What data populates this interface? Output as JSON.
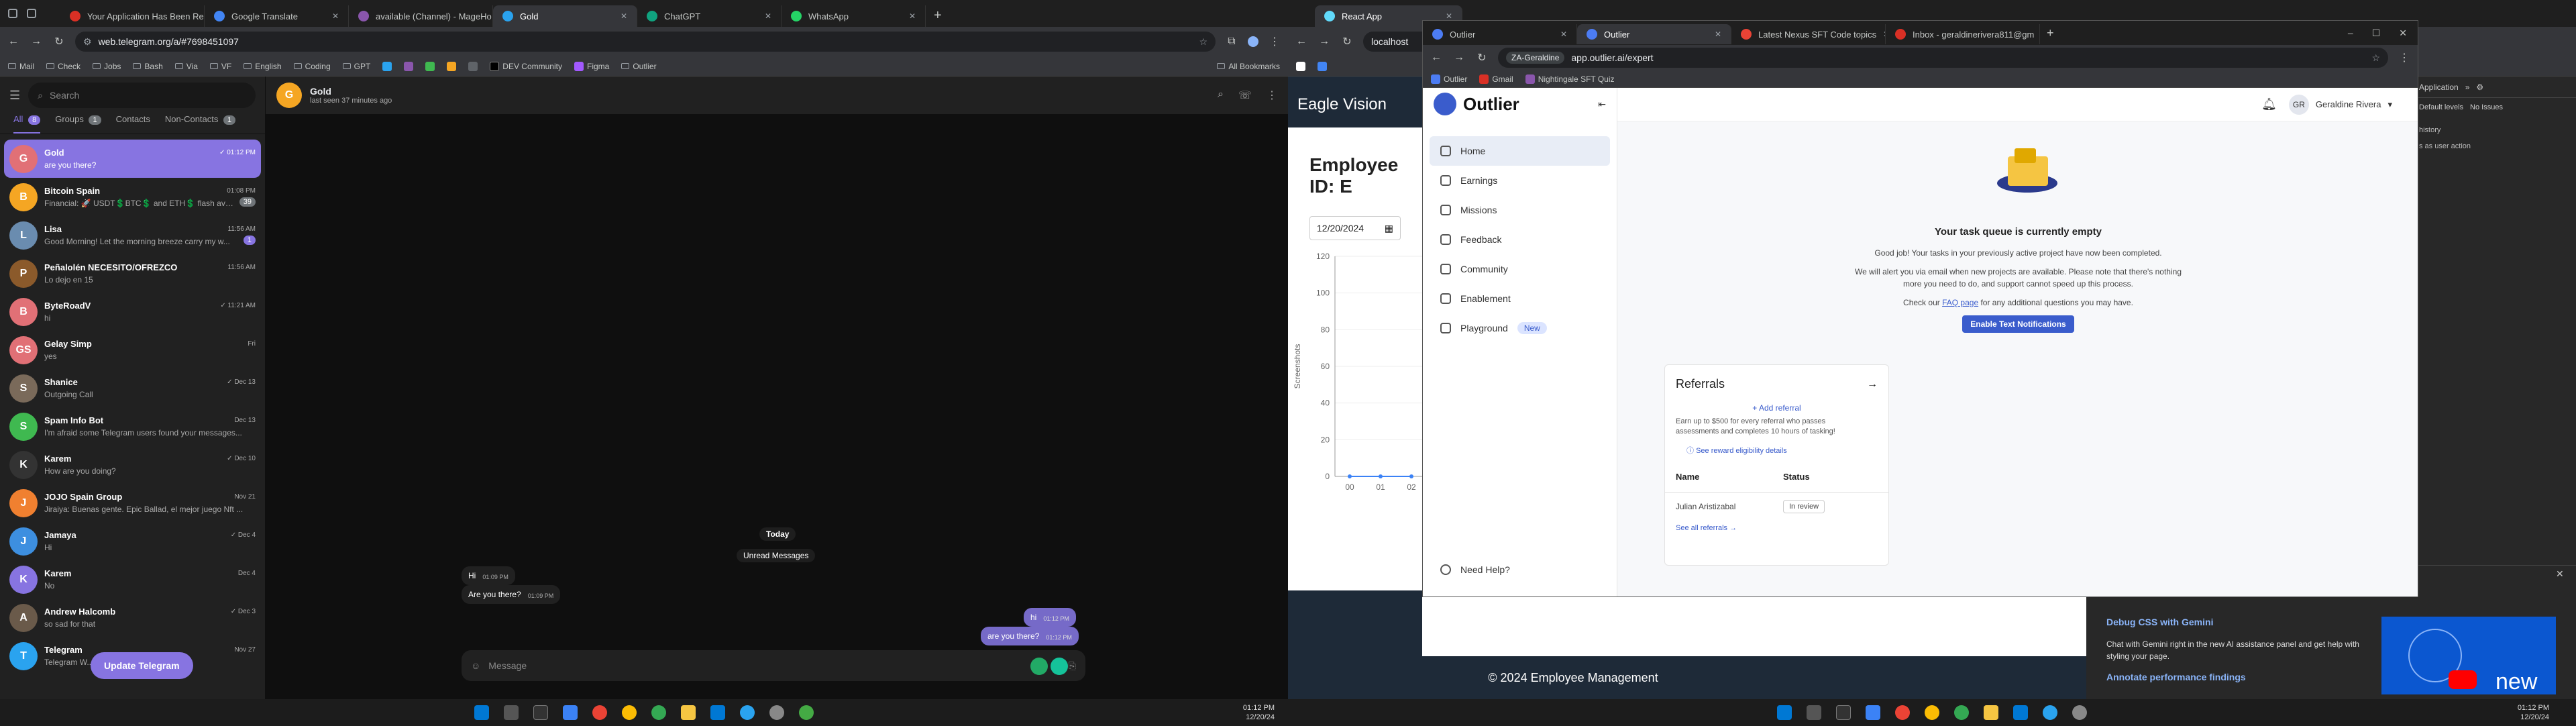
{
  "left_browser": {
    "tabs": [
      "Your Application Has Been Rec",
      "Google Translate",
      "available (Channel) - MageHo",
      "Gold",
      "ChatGPT",
      "WhatsApp"
    ],
    "active_tab": 3,
    "url": "web.telegram.org/a/#7698451097",
    "bookmarks": [
      "Mail",
      "Check",
      "Jobs",
      "Bash",
      "Via",
      "VF",
      "English",
      "Coding",
      "GPT",
      "DEV Community",
      "Figma",
      "Outlier"
    ],
    "all_bookmarks": "All Bookmarks"
  },
  "telegram": {
    "search_placeholder": "Search",
    "filters": [
      {
        "label": "All",
        "count": "8"
      },
      {
        "label": "Groups",
        "count": "1"
      },
      {
        "label": "Contacts",
        "count": ""
      },
      {
        "label": "Non-Contacts",
        "count": "1"
      }
    ],
    "chats": [
      {
        "name": "Gold",
        "time": "✓ 01:12 PM",
        "msg": "are you there?",
        "initial": "G",
        "color": "#e17076",
        "badge": ""
      },
      {
        "name": "Bitcoin Spain",
        "time": "01:08 PM",
        "msg": "Financial: 🚀 USDT💲BTC💲 and ETH💲 flash avail...",
        "initial": "B",
        "color": "#f5a623",
        "badge": "39"
      },
      {
        "name": "Lisa",
        "time": "11:56 AM",
        "msg": "Good Morning! Let the morning breeze carry my w...",
        "initial": "L",
        "color": "#6a8caf",
        "badge": "1"
      },
      {
        "name": "Peñalolén NECESITO/OFREZCO",
        "time": "11:56 AM",
        "msg": "Lo dejo en 15",
        "initial": "P",
        "color": "#8b5a2b",
        "badge": ""
      },
      {
        "name": "ByteRoadV",
        "time": "✓ 11:21 AM",
        "msg": "hi",
        "initial": "B",
        "color": "#e17076",
        "badge": ""
      },
      {
        "name": "Gelay Simp",
        "time": "Fri",
        "msg": "yes",
        "initial": "GS",
        "color": "#e17076",
        "badge": ""
      },
      {
        "name": "Shanice",
        "time": "✓ Dec 13",
        "msg": "Outgoing Call",
        "initial": "S",
        "color": "#7a6a5a",
        "badge": ""
      },
      {
        "name": "Spam Info Bot",
        "time": "Dec 13",
        "msg": "I'm afraid some Telegram users found your messages...",
        "initial": "S",
        "color": "#3fb950",
        "badge": ""
      },
      {
        "name": "Karem",
        "time": "✓ Dec 10",
        "msg": "How are you doing?",
        "initial": "K",
        "color": "#333",
        "badge": ""
      },
      {
        "name": "JOJO Spain Group",
        "time": "Nov 21",
        "msg": "Jiraiya: Buenas gente. Epic Ballad, el mejor juego Nft ...",
        "initial": "J",
        "color": "#f08030",
        "badge": ""
      },
      {
        "name": "Jamaya",
        "time": "✓ Dec 4",
        "msg": "Hi",
        "initial": "J",
        "color": "#3d8fe0",
        "badge": ""
      },
      {
        "name": "Karem",
        "time": "Dec 4",
        "msg": "No",
        "initial": "K",
        "color": "#8774e1",
        "badge": ""
      },
      {
        "name": "Andrew Halcomb",
        "time": "✓ Dec 3",
        "msg": "so sad for that",
        "initial": "A",
        "color": "#6a5a4a",
        "badge": ""
      },
      {
        "name": "Telegram",
        "time": "Nov 27",
        "msg": "Telegram W... features and useful...",
        "initial": "T",
        "color": "#2aa3ef",
        "badge": ""
      }
    ],
    "update_button": "Update Telegram",
    "header": {
      "name": "Gold",
      "status": "last seen 37 minutes ago",
      "initial": "G"
    },
    "date_label": "Today",
    "unread_label": "Unread Messages",
    "messages": [
      {
        "text": "Hi",
        "time": "01:09 PM",
        "out": false
      },
      {
        "text": "Are you there?",
        "time": "01:09 PM",
        "out": false
      },
      {
        "text": "hi",
        "time": "01:12 PM",
        "out": true
      },
      {
        "text": "are you there?",
        "time": "01:12 PM",
        "out": true
      }
    ],
    "message_placeholder": "Message"
  },
  "right_browser": {
    "tabs": [
      "React App"
    ],
    "url": "localhost",
    "page_title": "Eagle Vision",
    "heading": "Employee ID: E",
    "date_value": "12/20/2024",
    "chart_data": {
      "type": "line",
      "ylabel": "Screenshots",
      "yticks": [
        "120",
        "100",
        "80",
        "60",
        "40",
        "20",
        "0"
      ],
      "xticks": [
        "00",
        "01",
        "02"
      ],
      "ylim": [
        0,
        120
      ],
      "values": [
        0,
        0,
        0
      ]
    },
    "footer": "© 2024 Employee Management",
    "devtools": {
      "tabs": [
        "Application"
      ],
      "levels": "Default levels",
      "issues": "No Issues",
      "lines": [
        "history",
        "s as user action"
      ]
    },
    "gemini": {
      "title": "Debug CSS with Gemini",
      "desc": "Chat with Gemini right in the new AI assistance panel and get help with styling your page.",
      "link": "Annotate performance findings",
      "video_text": "new"
    }
  },
  "outlier_window": {
    "tabs": [
      "Outlier",
      "Outlier",
      "Latest Nexus SFT Code topics",
      "Inbox - geraldinerivera811@gm"
    ],
    "profile_chip": "ZA-Geraldine",
    "url": "app.outlier.ai/expert",
    "bookmarks": [
      "Outlier",
      "Gmail",
      "Nightingale SFT Quiz"
    ],
    "brand": "Outlier",
    "nav": [
      "Home",
      "Earnings",
      "Missions",
      "Feedback",
      "Community",
      "Enablement",
      "Playground"
    ],
    "nav_badge": "New",
    "need_help": "Need Help?",
    "user_initials": "GR",
    "user_name": "Geraldine Rivera",
    "queue_title": "Your task queue is currently empty",
    "queue_p1": "Good job! Your tasks in your previously active project have now been completed.",
    "queue_p2a": "We will alert you via email when new projects are available. Please note that there's nothing",
    "queue_p2b": "more you need to do, and support cannot speed up this process.",
    "queue_p3_pre": "Check our ",
    "queue_p3_link": "FAQ page",
    "queue_p3_post": " for any additional questions you may have.",
    "enable_btn": "Enable Text Notifications",
    "referrals": {
      "title": "Referrals",
      "add": "Add referral",
      "earn1": "Earn up to $500 for every referral who passes",
      "earn2": "assessments and completes 10 hours of tasking!",
      "eligibility": "See reward eligibility details",
      "col_name": "Name",
      "col_status": "Status",
      "row_name": "Julian Aristizabal",
      "row_status": "In review",
      "see_all": "See all referrals"
    }
  },
  "taskbar": {
    "time_left": "01:12 PM",
    "date_left": "12/20/24",
    "time_right": "01:12 PM",
    "date_right": "12/20/24"
  }
}
